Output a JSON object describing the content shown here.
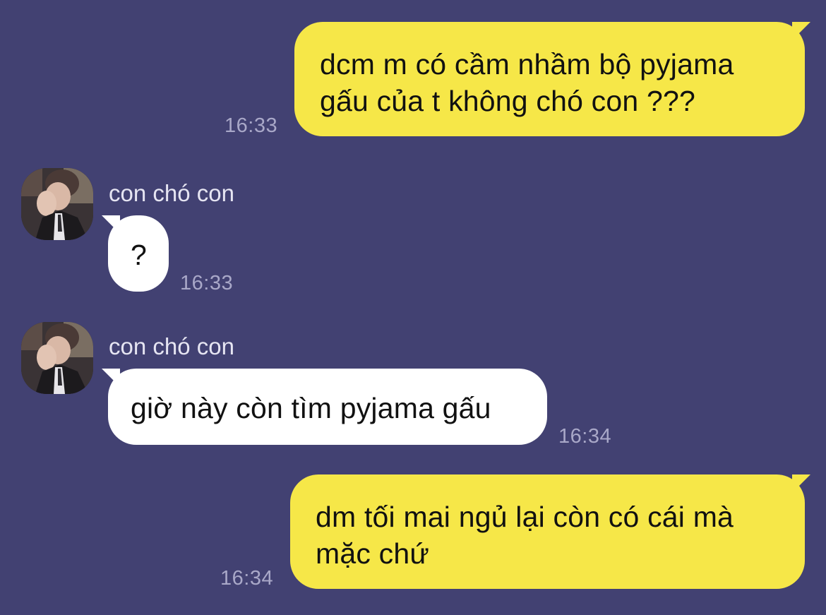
{
  "messages": [
    {
      "direction": "outgoing",
      "lines": [
        "dcm m có cầm nhầm bộ pyjama",
        "gấu của t không chó con ???"
      ],
      "time": "16:33"
    },
    {
      "direction": "incoming",
      "sender": "con chó con",
      "avatar": "avatar-photo",
      "text": "?",
      "time": "16:33"
    },
    {
      "direction": "incoming",
      "sender": "con chó con",
      "avatar": "avatar-photo",
      "text": "giờ này còn tìm pyjama gấu",
      "time": "16:34"
    },
    {
      "direction": "outgoing",
      "lines": [
        "dm tối mai ngủ lại còn có cái mà",
        "mặc chứ"
      ],
      "time": "16:34"
    }
  ],
  "colors": {
    "background": "#424172",
    "outgoing_bubble": "#f6e748",
    "incoming_bubble": "#ffffff",
    "timestamp": "#a9a8c8"
  }
}
